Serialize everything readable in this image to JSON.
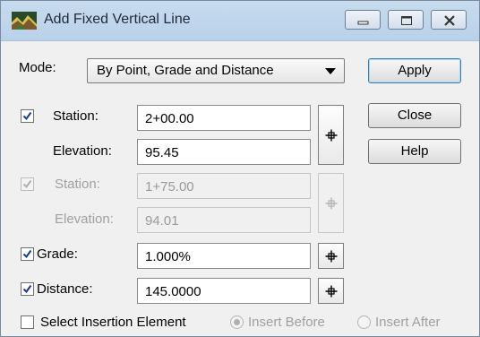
{
  "window": {
    "title": "Add Fixed Vertical Line"
  },
  "mode": {
    "label": "Mode:",
    "value": "By Point, Grade and Distance"
  },
  "point1": {
    "station_label": "Station:",
    "station_value": "2+00.00",
    "station_checked": true,
    "elevation_label": "Elevation:",
    "elevation_value": "95.45"
  },
  "point2": {
    "station_label": "Station:",
    "station_value": "1+75.00",
    "station_checked": true,
    "enabled": false,
    "elevation_label": "Elevation:",
    "elevation_value": "94.01"
  },
  "grade": {
    "label": "Grade:",
    "value": "1.000%",
    "checked": true
  },
  "distance": {
    "label": "Distance:",
    "value": "145.0000",
    "checked": true
  },
  "insertion": {
    "select_label": "Select Insertion Element",
    "select_checked": false,
    "insert_before_label": "Insert Before",
    "insert_before_selected": true,
    "insert_after_label": "Insert After",
    "insert_after_selected": false
  },
  "buttons": {
    "apply": "Apply",
    "close": "Close",
    "help": "Help"
  },
  "icons": {
    "app": "road-profile-icon",
    "locate": "crosshair-icon"
  }
}
